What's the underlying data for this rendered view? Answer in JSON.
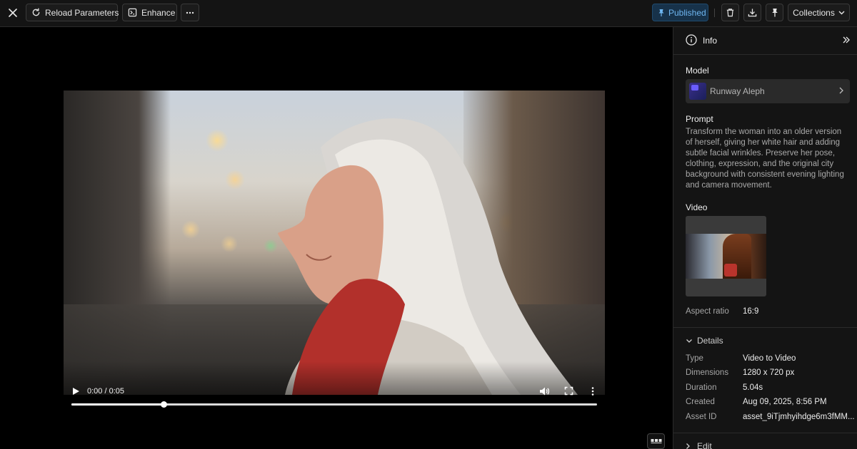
{
  "toolbar": {
    "reload_label": "Reload Parameters",
    "enhance_label": "Enhance",
    "published_label": "Published",
    "collections_label": "Collections"
  },
  "player": {
    "time": "0:00 / 0:05",
    "progress": 0.175
  },
  "panel": {
    "title": "Info",
    "model_label": "Model",
    "model_name": "Runway Aleph",
    "prompt_label": "Prompt",
    "prompt_text": "Transform the woman into an older version of herself, giving her white hair and adding subtle facial wrinkles. Preserve her pose, clothing, expression, and the original city background with consistent evening lighting and camera movement.",
    "video_label": "Video",
    "aspect_label": "Aspect ratio",
    "aspect_value": "16:9",
    "details_label": "Details",
    "details": [
      {
        "label": "Type",
        "value": "Video to Video"
      },
      {
        "label": "Dimensions",
        "value": "1280 x 720 px"
      },
      {
        "label": "Duration",
        "value": "5.04s"
      },
      {
        "label": "Created",
        "value": "Aug 09, 2025, 8:56 PM"
      },
      {
        "label": "Asset ID",
        "value": "asset_9iTjmhyihdge6m3fMM..."
      }
    ],
    "edit_label": "Edit"
  },
  "colors": {
    "accent": "#6fb6f0",
    "published_bg": "#17324a",
    "panel_bg": "#141414"
  }
}
